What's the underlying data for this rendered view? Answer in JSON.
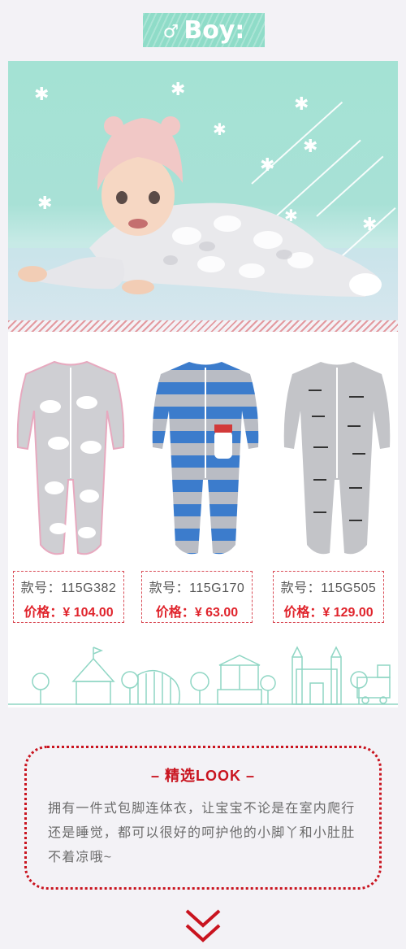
{
  "header": {
    "symbol": "♂",
    "title": "Boy:"
  },
  "products": [
    {
      "sku_label": "款号：115G382",
      "price_label": "价格：",
      "price": "¥ 104.00"
    },
    {
      "sku_label": "款号：115G170",
      "price_label": "价格：",
      "price": "¥ 63.00"
    },
    {
      "sku_label": "款号：115G505",
      "price_label": "价格：",
      "price": "¥ 129.00"
    }
  ],
  "look": {
    "title": "– 精选LOOK –",
    "text": "拥有一件式包脚连体衣，让宝宝不论是在室内爬行还是睡觉，都可以很好的呵护他的小脚丫和小肚肚不着凉哦~"
  },
  "colors": {
    "accent_red": "#c9141f",
    "mint": "#8fdcc8"
  },
  "icons": [
    "male-symbol-icon",
    "double-chevron-down-icon"
  ]
}
